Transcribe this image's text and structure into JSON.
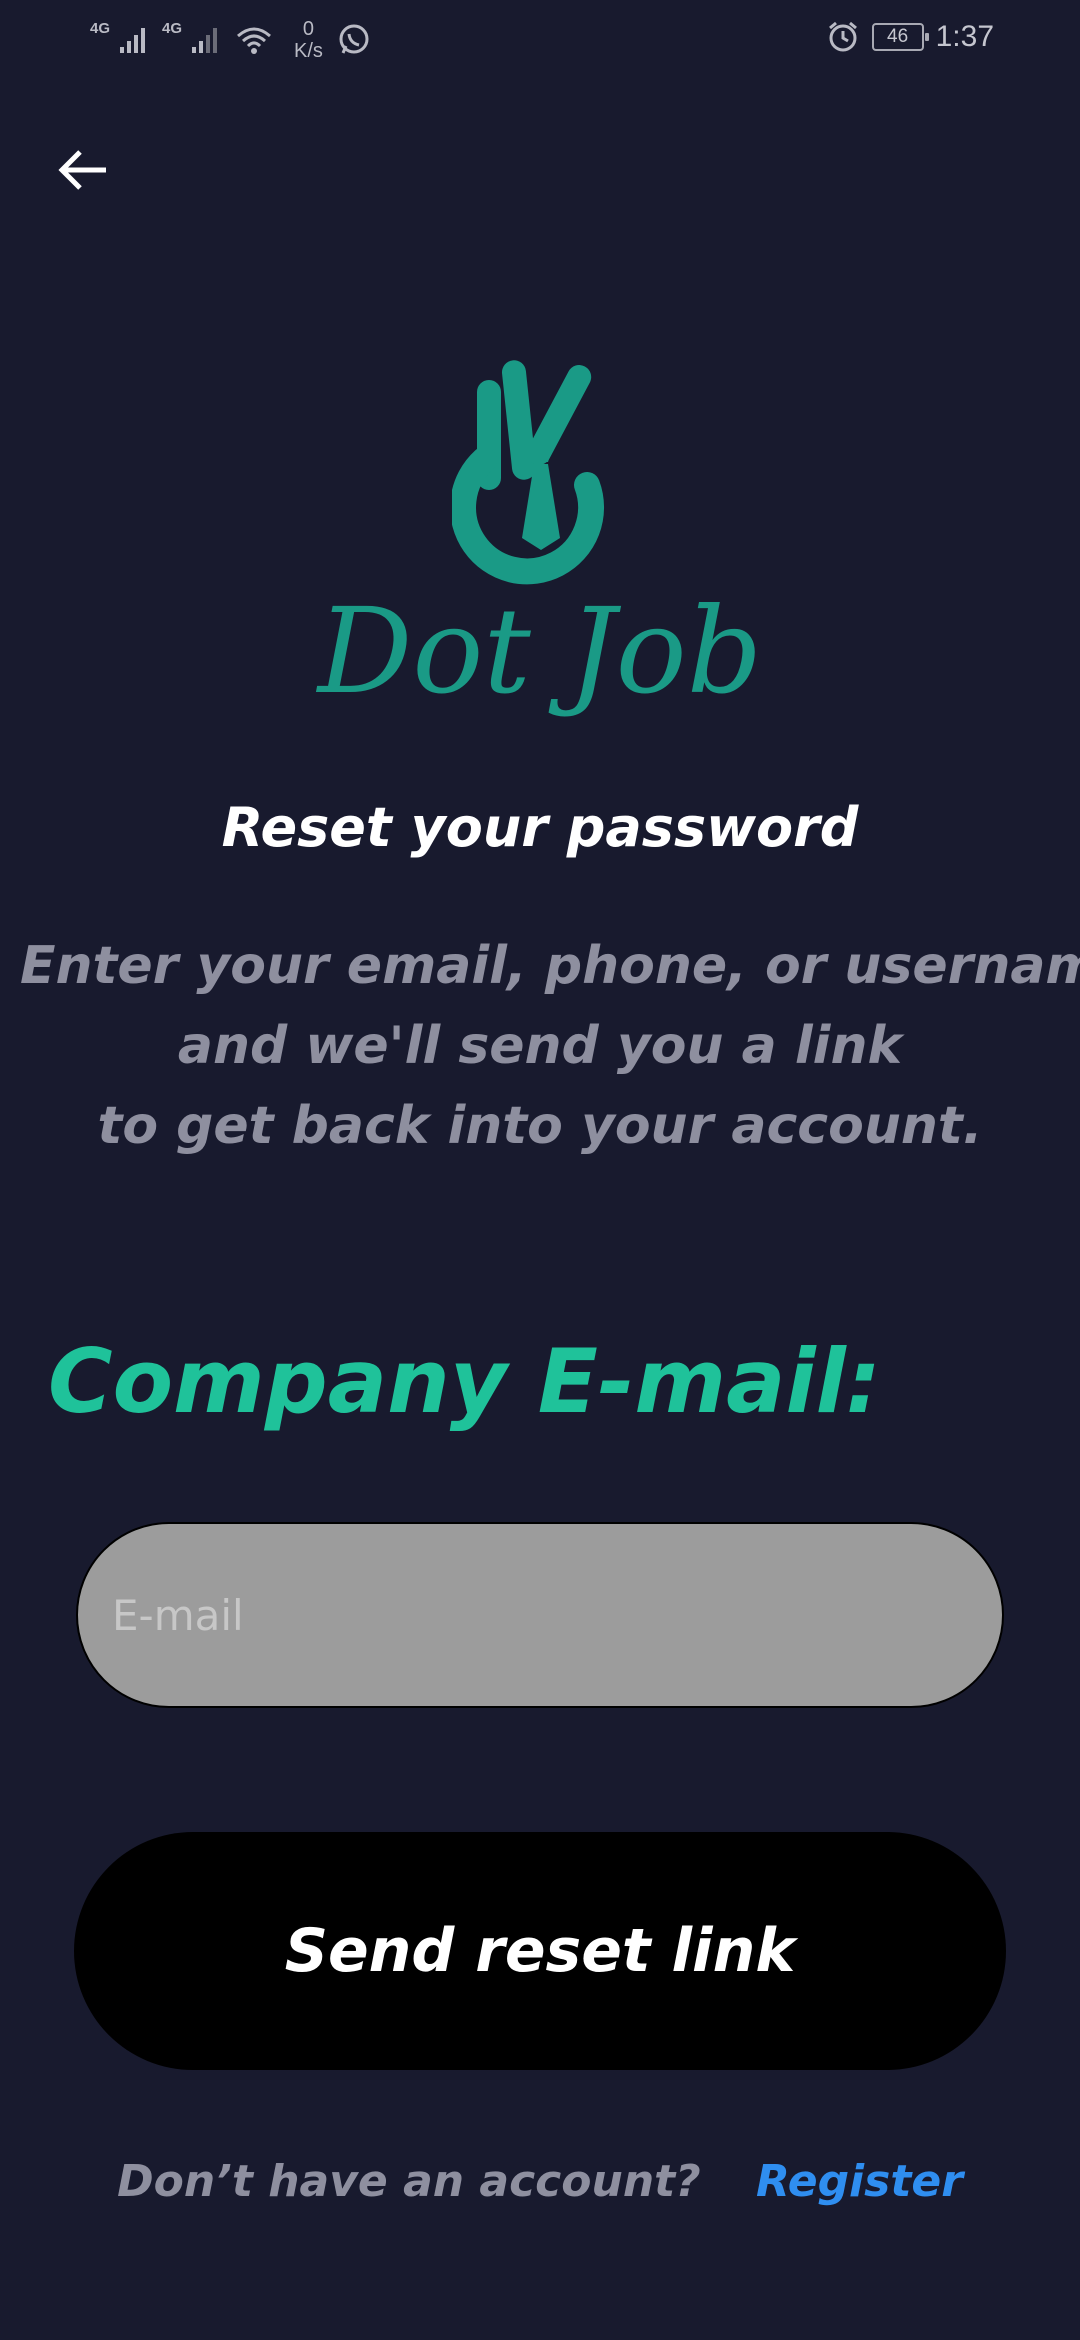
{
  "status_bar": {
    "network_1": "4G",
    "network_2": "4G",
    "speed_value": "0",
    "speed_unit": "K/s",
    "battery_level": "46",
    "time": "1:37",
    "icons": [
      "signal-icon",
      "signal-icon",
      "wifi-icon",
      "whatsapp-icon",
      "alarm-icon",
      "battery-icon"
    ]
  },
  "navigation": {
    "back_icon": "arrow-left-icon"
  },
  "brand": {
    "logo_text": "Dot Job",
    "logo_color": "#1a9a86"
  },
  "content": {
    "title": "Reset your password",
    "subtitle_lines": [
      "Enter your email, phone, or username",
      "and we'll send you a link",
      "to get back into your account."
    ],
    "field_label": "Company E-mail:",
    "email_placeholder": "E-mail",
    "email_value": "",
    "send_button_label": "Send reset link"
  },
  "footer": {
    "prompt": "Don’t have an account?",
    "register_label": "Register"
  },
  "colors": {
    "background": "#181a2e",
    "accent_green": "#1fc29a",
    "link_blue": "#2f8ef0",
    "input_bg": "#9c9c9c",
    "button_bg": "#000000"
  }
}
